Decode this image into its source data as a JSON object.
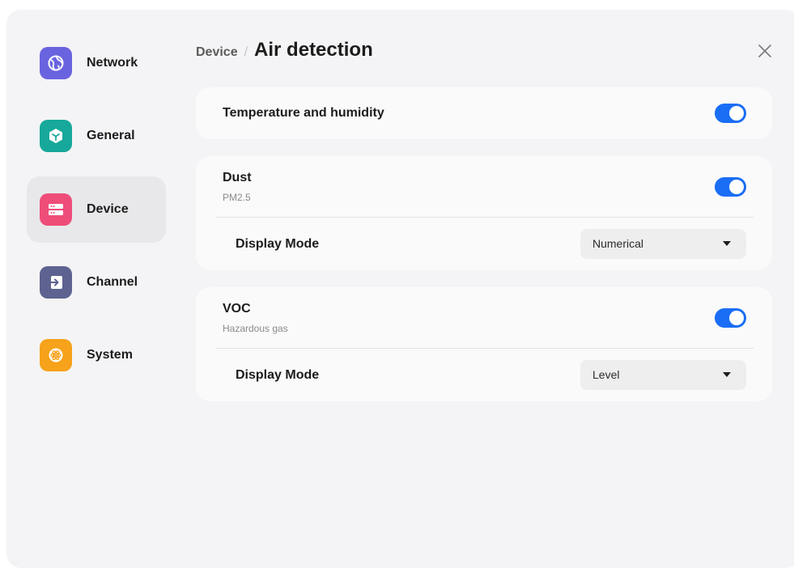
{
  "sidebar": {
    "items": [
      {
        "label": "Network",
        "icon": "globe-icon",
        "color": "#6a63e0",
        "active": false
      },
      {
        "label": "General",
        "icon": "cube-icon",
        "color": "#16a89a",
        "active": false
      },
      {
        "label": "Device",
        "icon": "server-icon",
        "color": "#ee4d79",
        "active": true
      },
      {
        "label": "Channel",
        "icon": "input-icon",
        "color": "#5d6290",
        "active": false
      },
      {
        "label": "System",
        "icon": "atom-icon",
        "color": "#f6a21a",
        "active": false
      }
    ]
  },
  "header": {
    "parent": "Device",
    "separator": "/",
    "title": "Air detection",
    "close_icon": "close-icon"
  },
  "sections": {
    "temperature": {
      "title": "Temperature and humidity",
      "enabled": true
    },
    "dust": {
      "title": "Dust",
      "subtitle": "PM2.5",
      "enabled": true,
      "display_mode_label": "Display Mode",
      "display_mode_value": "Numerical"
    },
    "voc": {
      "title": "VOC",
      "subtitle": "Hazardous gas",
      "enabled": true,
      "display_mode_label": "Display Mode",
      "display_mode_value": "Level"
    }
  },
  "colors": {
    "accent": "#1a6ef5",
    "background": "#f4f4f6",
    "card": "#fafafa"
  }
}
